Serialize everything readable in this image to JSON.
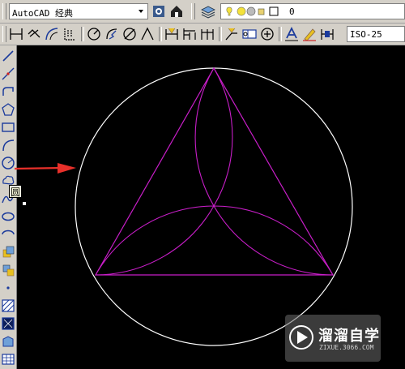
{
  "toolbar1": {
    "workspace_combo": {
      "value": "AutoCAD 经典"
    },
    "layer_combo": {
      "value": "0"
    }
  },
  "toolbar2": {
    "dimstyle_combo": {
      "value": "ISO-25"
    }
  },
  "left_toolbar": {
    "items": [
      "line",
      "construction-line",
      "polyline",
      "polygon",
      "rectangle",
      "arc",
      "circle",
      "revcloud",
      "spline",
      "ellipse",
      "ellipse-arc",
      "insert-block",
      "make-block",
      "point",
      "hatch",
      "gradient",
      "region",
      "table"
    ]
  },
  "tooltip": {
    "text": "圆"
  },
  "watermark": {
    "text": "溜溜自学",
    "sub": "ZIXUE.3066.COM"
  },
  "colors": {
    "canvas": "#000000",
    "drawing_lines": "#c81ec8",
    "outer_circle": "#ffffff",
    "arrow": "#e8302a"
  }
}
